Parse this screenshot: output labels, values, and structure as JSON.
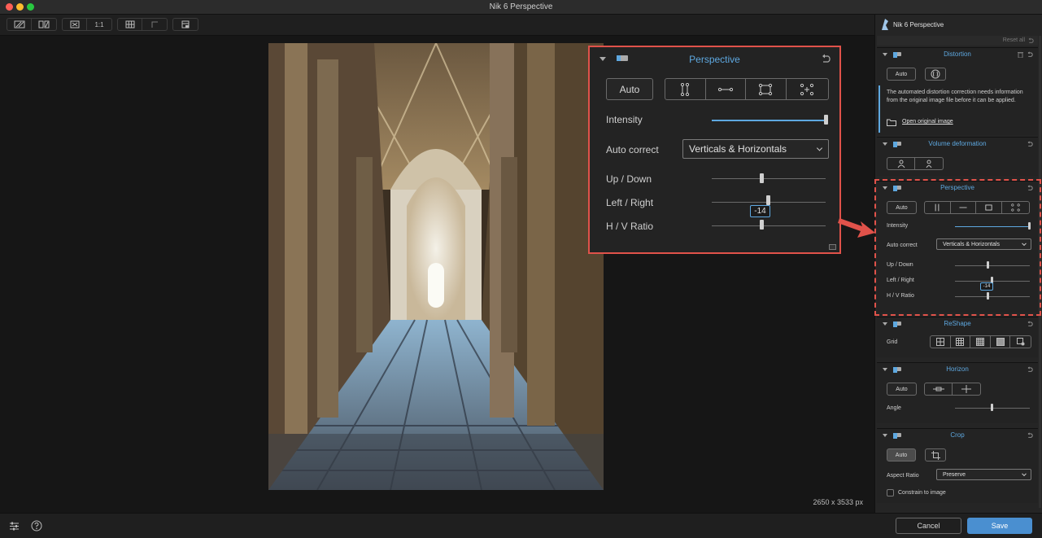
{
  "window": {
    "title": "Nik 6 Perspective"
  },
  "toolbar": {
    "zoom_label": "1:1"
  },
  "canvas": {
    "dimensions": "2650 x 3533 px"
  },
  "zoom_panel": {
    "title": "Perspective",
    "auto_label": "Auto",
    "intensity_label": "Intensity",
    "intensity_value": 1.0,
    "auto_correct_label": "Auto correct",
    "auto_correct_value": "Verticals & Horizontals",
    "up_down_label": "Up / Down",
    "left_right_label": "Left / Right",
    "hv_ratio_label": "H / V Ratio",
    "badge_value": "-14",
    "up_down_value": 0.44,
    "left_right_value": 0.5,
    "hv_ratio_value": 0.44
  },
  "panel": {
    "title": "Nik 6 Perspective",
    "reset_all": "Reset all",
    "distortion": {
      "title": "Distortion",
      "auto_label": "Auto",
      "info_text": "The automated distortion correction needs information from the original image file before it can be applied.",
      "link_text": "Open original image"
    },
    "volume": {
      "title": "Volume deformation"
    },
    "perspective": {
      "title": "Perspective",
      "auto_label": "Auto",
      "intensity_label": "Intensity",
      "auto_correct_label": "Auto correct",
      "auto_correct_value": "Verticals & Horizontals",
      "up_down_label": "Up / Down",
      "left_right_label": "Left / Right",
      "hv_ratio_label": "H / V Ratio",
      "badge_value": "-14"
    },
    "reshape": {
      "title": "ReShape",
      "grid_label": "Grid"
    },
    "horizon": {
      "title": "Horizon",
      "auto_label": "Auto",
      "angle_label": "Angle",
      "angle_value": 0.5
    },
    "crop": {
      "title": "Crop",
      "auto_label": "Auto",
      "aspect_label": "Aspect Ratio",
      "aspect_value": "Preserve",
      "constrain_label": "Constrain to image"
    }
  },
  "bottom": {
    "cancel_label": "Cancel",
    "save_label": "Save"
  },
  "colors": {
    "accent": "#5ea8e0",
    "highlight": "#e0524a",
    "save": "#4a8fd0"
  },
  "icons": [
    "adjust-sliders-icon",
    "help-icon",
    "undo-icon",
    "trash-icon",
    "folder-icon"
  ]
}
